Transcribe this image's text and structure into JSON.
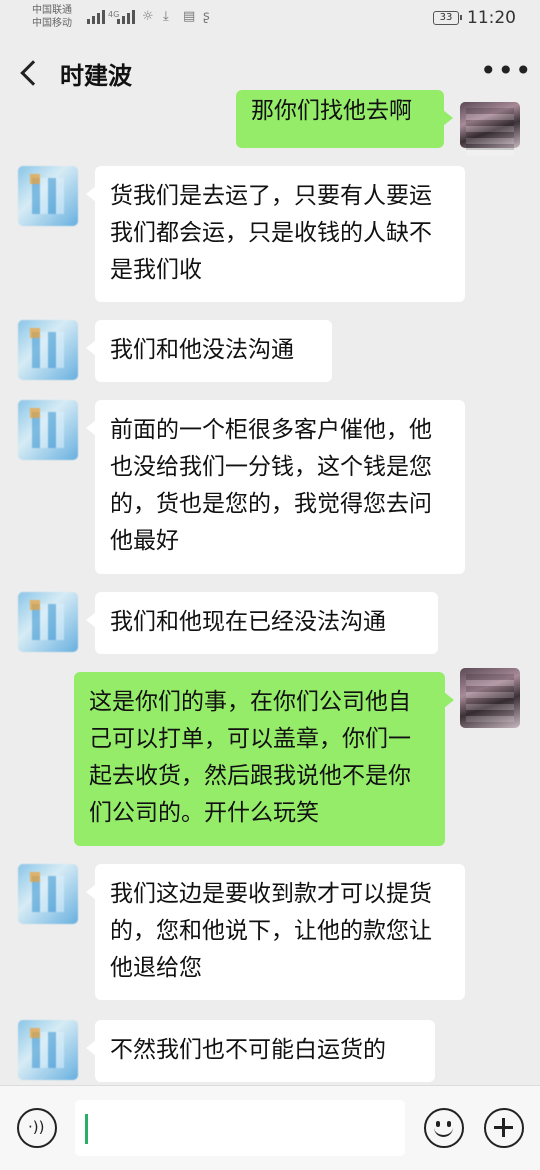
{
  "status_bar": {
    "carrier_1": "中国联通",
    "carrier_2": "中国移动",
    "network_1": "4G",
    "battery": "33",
    "time": "11:20"
  },
  "header": {
    "title": "时建波",
    "back_icon": "chevron-left-icon",
    "more_icon": "more-horizontal-icon",
    "more_glyph": "•••"
  },
  "messages": [
    {
      "sender": "self",
      "text": "那你们找他去啊"
    },
    {
      "sender": "other",
      "text": "货我们是去运了，只要有人要运我们都会运，只是收钱的人缺不是我们收"
    },
    {
      "sender": "other",
      "text": "我们和他没法沟通"
    },
    {
      "sender": "other",
      "text": "前面的一个柜很多客户催他，他也没给我们一分钱，这个钱是您的，货也是您的，我觉得您去问他最好"
    },
    {
      "sender": "other",
      "text": "我们和他现在已经没法沟通"
    },
    {
      "sender": "self",
      "text": "这是你们的事，在你们公司他自己可以打单，可以盖章，你们一起去收货，然后跟我说他不是你们公司的。开什么玩笑"
    },
    {
      "sender": "other",
      "text": "我们这边是要收到款才可以提货的，您和他说下，让他的款您让他退给您"
    },
    {
      "sender": "other",
      "text": "不然我们也不可能白运货的"
    }
  ],
  "input_bar": {
    "voice_icon": "voice-icon",
    "voice_glyph": "·))",
    "input_value": "",
    "emoji_icon": "emoji-icon",
    "plus_icon": "plus-icon"
  },
  "colors": {
    "background": "#ededed",
    "self_bubble": "#95ec69",
    "other_bubble": "#ffffff",
    "caret": "#2aae67"
  }
}
